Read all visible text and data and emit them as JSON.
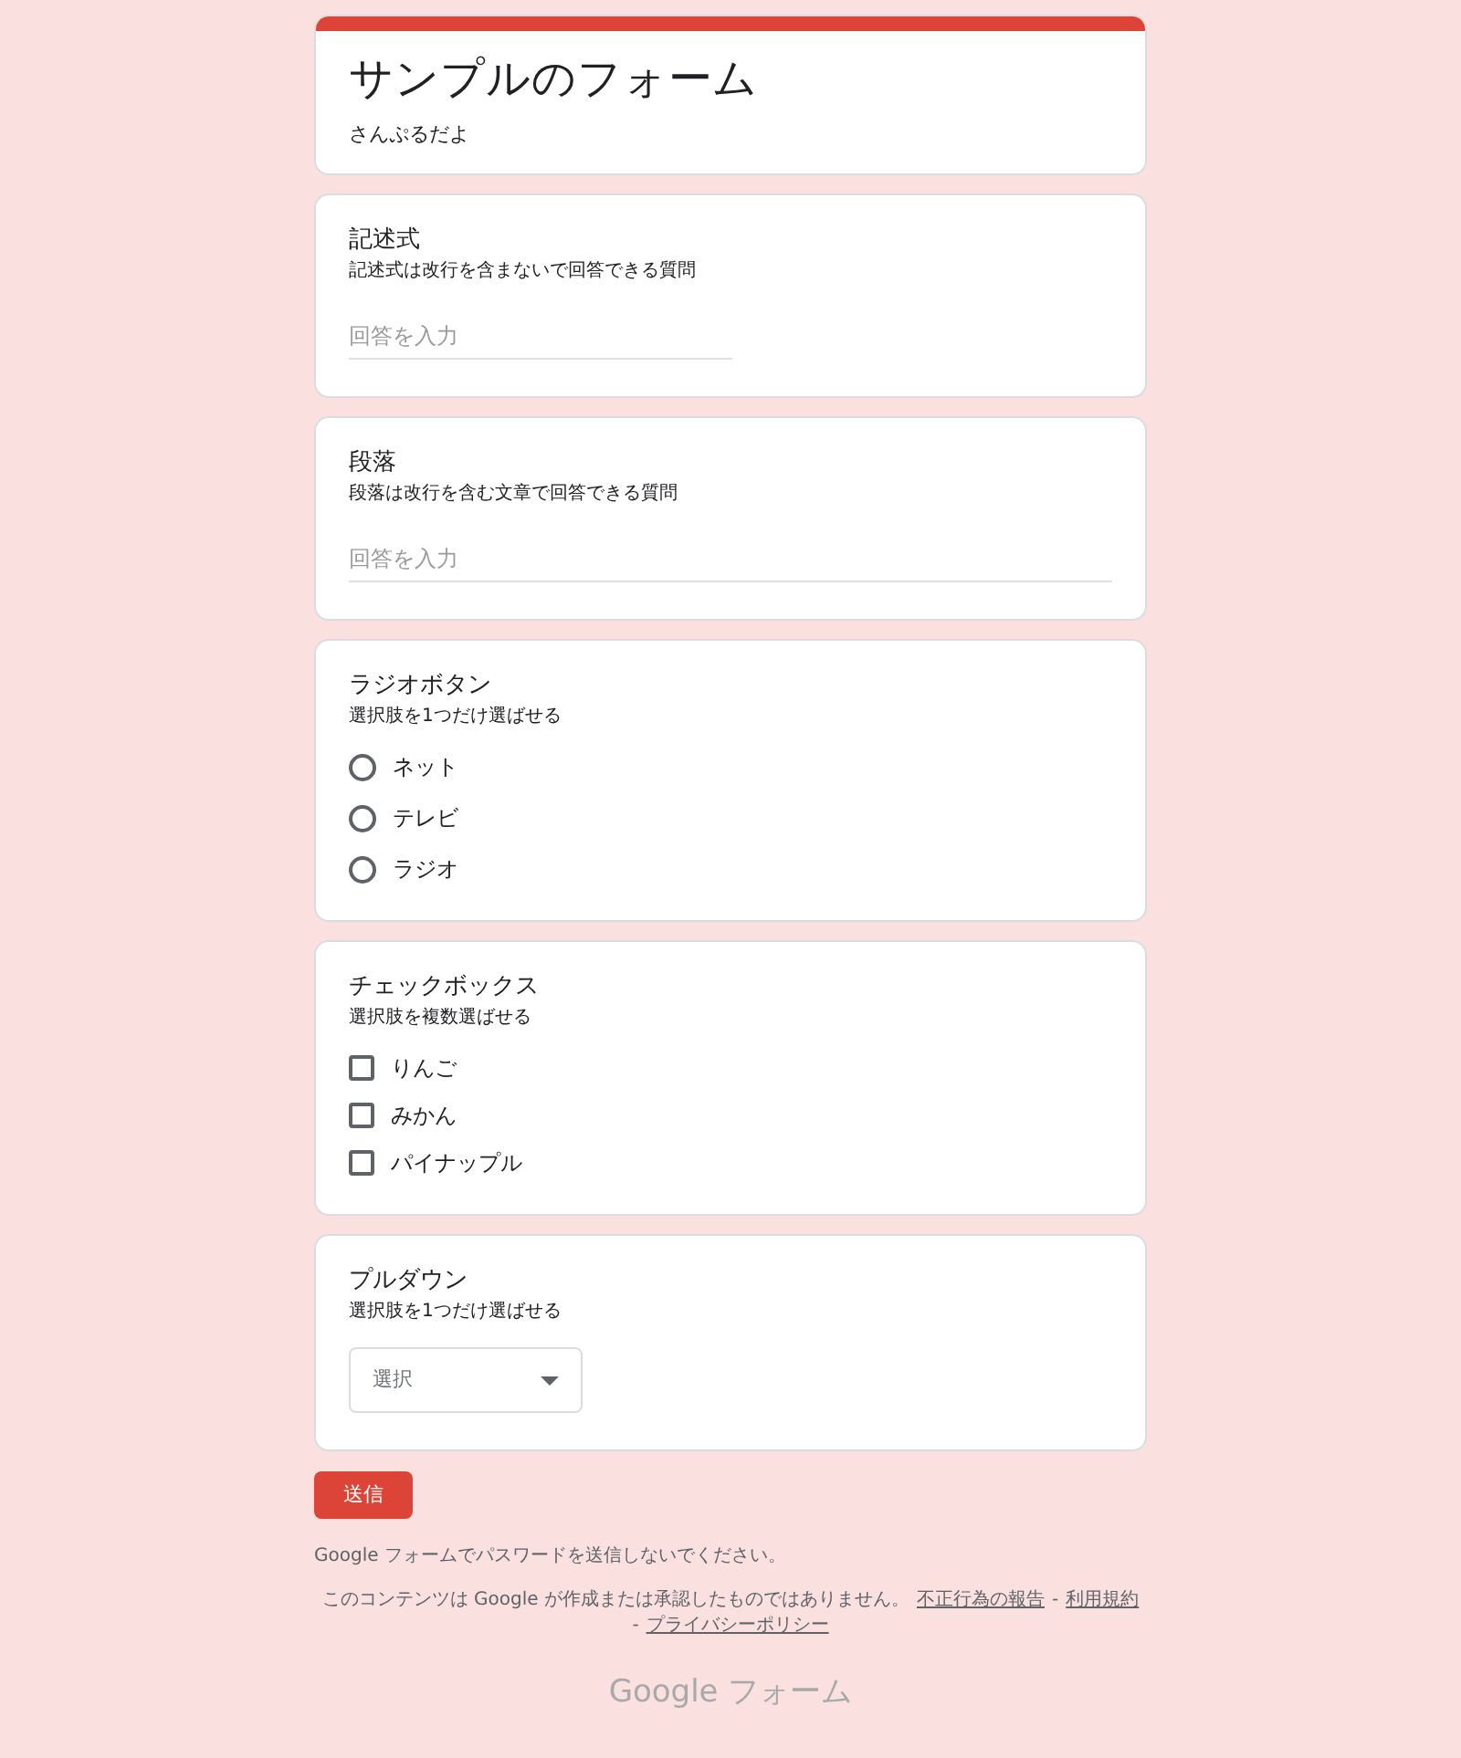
{
  "header": {
    "title": "サンプルのフォーム",
    "description": "さんぷるだよ"
  },
  "questions": [
    {
      "kind": "short",
      "title": "記述式",
      "help": "記述式は改行を含まないで回答できる質問",
      "placeholder": "回答を入力"
    },
    {
      "kind": "paragraph",
      "title": "段落",
      "help": "段落は改行を含む文章で回答できる質問",
      "placeholder": "回答を入力"
    },
    {
      "kind": "radio",
      "title": "ラジオボタン",
      "help": "選択肢を1つだけ選ばせる",
      "options": [
        {
          "label": "ネット",
          "selected": false
        },
        {
          "label": "テレビ",
          "selected": false
        },
        {
          "label": "ラジオ",
          "selected": false
        }
      ]
    },
    {
      "kind": "checkbox",
      "title": "チェックボックス",
      "help": "選択肢を複数選ばせる",
      "options": [
        {
          "label": "りんご",
          "checked": false
        },
        {
          "label": "みかん",
          "checked": false
        },
        {
          "label": "パイナップル",
          "checked": false
        }
      ]
    },
    {
      "kind": "dropdown",
      "title": "プルダウン",
      "help": "選択肢を1つだけ選ばせる",
      "placeholder": "選択"
    }
  ],
  "submit": "送信",
  "footer": {
    "warning": "Google フォームでパスワードを送信しないでください。",
    "notice": "このコンテンツは Google が作成または承認したものではありません。",
    "links": [
      "不正行為の報告",
      "利用規約",
      "プライバシーポリシー"
    ],
    "separator": "-",
    "brand": "Google フォーム"
  }
}
